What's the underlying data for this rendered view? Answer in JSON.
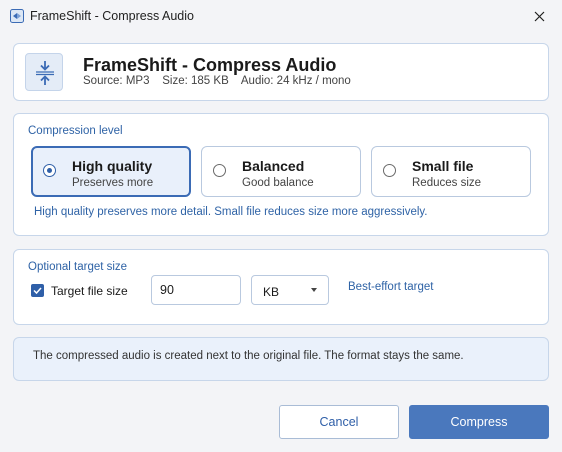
{
  "window": {
    "title": "FrameShift - Compress Audio"
  },
  "header": {
    "title": "FrameShift - Compress Audio",
    "meta": "Source: MP3    Size: 185 KB    Audio: 24 kHz / mono"
  },
  "compression": {
    "label": "Compression level",
    "options": [
      {
        "title": "High quality",
        "subtitle": "Preserves more",
        "selected": true
      },
      {
        "title": "Balanced",
        "subtitle": "Good balance",
        "selected": false
      },
      {
        "title": "Small file",
        "subtitle": "Reduces size",
        "selected": false
      }
    ],
    "help": "High quality preserves more detail. Small file reduces size more aggressively."
  },
  "target": {
    "label": "Optional target size",
    "checkbox_label": "Target file size",
    "checked": true,
    "value": "90",
    "unit": "KB",
    "note": "Best-effort target"
  },
  "info": {
    "text": "The compressed audio is created next to the original file. The format stays the same."
  },
  "buttons": {
    "cancel": "Cancel",
    "compress": "Compress"
  },
  "colors": {
    "accent": "#2f5fa8",
    "primary_button": "#4a78bd",
    "link_text": "#2f63a6"
  }
}
